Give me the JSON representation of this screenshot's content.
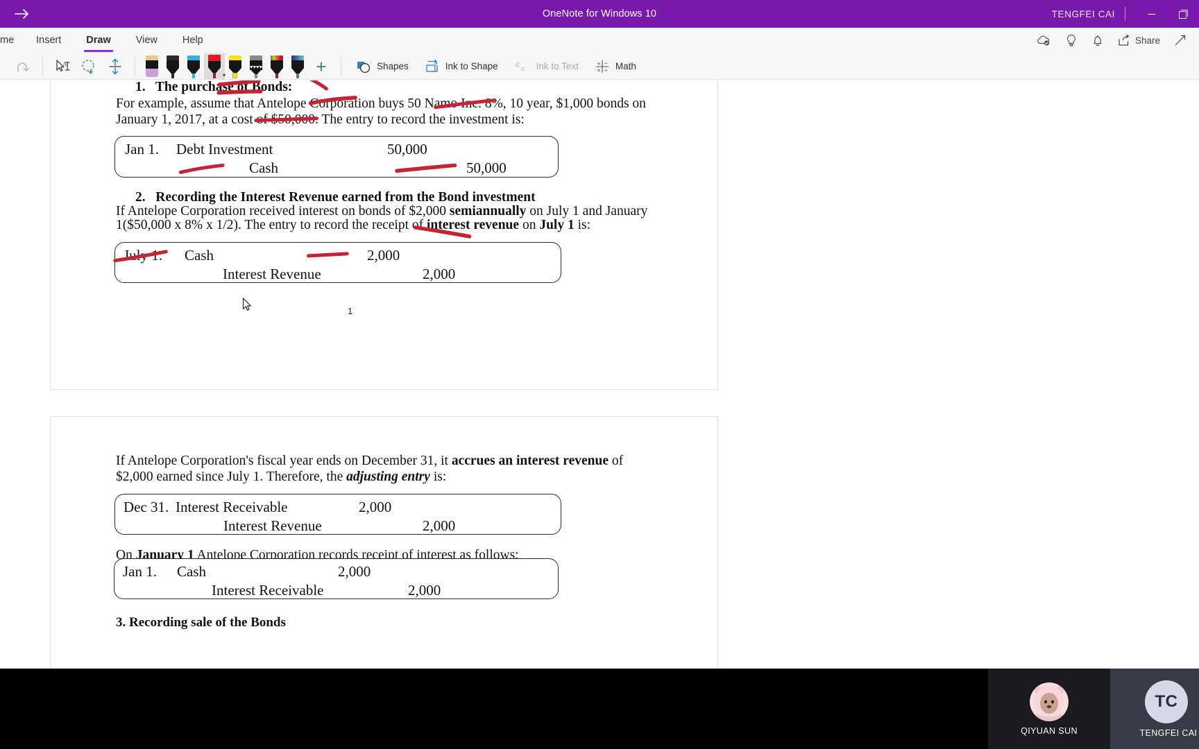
{
  "titlebar": {
    "back_icon": "arrow-right-icon",
    "title": "OneNote for Windows 10",
    "user": "TENGFEI CAI",
    "minimize_label": "Minimize",
    "restore_label": "Restore Down"
  },
  "ribbon": {
    "tabs": [
      {
        "label": "me",
        "name": "tab-home-partial",
        "active": false
      },
      {
        "label": "Insert",
        "name": "tab-insert",
        "active": false
      },
      {
        "label": "Draw",
        "name": "tab-draw",
        "active": true
      },
      {
        "label": "View",
        "name": "tab-view",
        "active": false
      },
      {
        "label": "Help",
        "name": "tab-help",
        "active": false
      }
    ],
    "right_actions": [
      {
        "label": "",
        "icon": "sync-cloud-icon",
        "name": "sync-status-button"
      },
      {
        "label": "",
        "icon": "lightbulb-icon",
        "name": "tell-me-button"
      },
      {
        "label": "",
        "icon": "bell-icon",
        "name": "notifications-button"
      },
      {
        "label": "Share",
        "icon": "share-icon",
        "name": "share-button"
      },
      {
        "label": "",
        "icon": "expand-diagonal-icon",
        "name": "full-page-view-button"
      }
    ],
    "tools": {
      "redo": {
        "label": "Redo",
        "icon": "redo-arrow-icon",
        "disabled": true
      },
      "type": {
        "label": "Type",
        "icon": "select-type-icon",
        "disabled": false
      },
      "lasso": {
        "label": "Lasso Select",
        "icon": "lasso-select-icon",
        "disabled": false
      },
      "insert_space": {
        "label": "Insert Space",
        "icon": "insert-space-icon",
        "disabled": false
      },
      "add_pen": {
        "label": "Add Pen",
        "icon": "plus-icon",
        "disabled": false
      },
      "shapes": {
        "label": "Shapes",
        "icon": "shapes-icon",
        "disabled": false
      },
      "ink_to_shape": {
        "label": "Ink to Shape",
        "icon": "ink-to-shape-icon",
        "disabled": false
      },
      "ink_to_text": {
        "label": "Ink to Text",
        "icon": "ink-to-text-icon",
        "disabled": true
      },
      "math": {
        "label": "Math",
        "icon": "math-icon",
        "disabled": false
      }
    },
    "pens": [
      {
        "name": "pen-eraser",
        "label": "Eraser",
        "cap": "#e8c98a",
        "nib": "#cf9fdc",
        "type": "erase",
        "selected": false
      },
      {
        "name": "pen-black",
        "label": "Black Pen",
        "cap": "#2b2b2b",
        "nib": "#2b2b2b",
        "type": "pen",
        "selected": false
      },
      {
        "name": "pen-blue",
        "label": "Blue Pen",
        "cap": "#2fb3e0",
        "nib": "#2fb3e0",
        "type": "pen",
        "selected": false
      },
      {
        "name": "pen-red",
        "label": "Red Pen",
        "cap": "#e01b24",
        "nib": "#8e2230",
        "type": "pen",
        "selected": true
      },
      {
        "name": "highlighter-yellow",
        "label": "Yellow Highlighter",
        "cap": "#f7e01c",
        "nib": "#f7e01c",
        "type": "hl",
        "selected": false
      },
      {
        "name": "pencil-grey",
        "label": "Pencil",
        "cap": "#8b8b8b",
        "nib": "#8b8b8b",
        "type": "pencil",
        "selected": false
      },
      {
        "name": "pen-rainbow",
        "label": "Rainbow Pen",
        "cap": "rainbow",
        "nib": "#8e2230",
        "type": "pen",
        "selected": false
      },
      {
        "name": "pen-galaxy",
        "label": "Galaxy Pen",
        "cap": "galaxy",
        "nib": "#4a7f9c",
        "type": "pen",
        "selected": false
      }
    ]
  },
  "document": {
    "page1": {
      "section1_number": "1.",
      "section1_heading": "The purchase of Bonds:",
      "para1_line1": "For example, assume that Antelope Corporation buys 50 Namo Inc. 8%, 10 year, $1,000 bonds on",
      "para1_line2": "January 1, 2017, at a cost of $50,000. The entry to record the investment is:",
      "entry1": {
        "date": "Jan 1.",
        "debit_account": "Debt Investment",
        "debit_amount": "50,000",
        "credit_account": "Cash",
        "credit_amount": "50,000"
      },
      "section2_number": "2.",
      "section2_heading": "Recording the Interest Revenue earned from the Bond investment",
      "para2_line1_a": "If Antelope Corporation received interest on bonds of $2,000 ",
      "para2_line1_b": "semiannually",
      "para2_line1_c": " on July 1 and January",
      "para2_line2_a": "1($50,000 x 8% x 1/2). The entry to record the receipt of ",
      "para2_line2_b": "interest revenue",
      "para2_line2_c": " on ",
      "para2_line2_d": "July 1",
      "para2_line2_e": " is:",
      "entry2": {
        "date": "July 1.",
        "debit_account": "Cash",
        "debit_amount": "2,000",
        "credit_account": "Interest Revenue",
        "credit_amount": "2,000"
      },
      "page_number": "1"
    },
    "page2": {
      "para3_line1_a": "If Antelope Corporation's fiscal year ends on December 31, it ",
      "para3_line1_b": "accrues an interest revenue",
      "para3_line1_c": " of",
      "para3_line2_a": "$2,000 earned since July 1. Therefore, the ",
      "para3_line2_b": "adjusting entry",
      "para3_line2_c": " is:",
      "entry3": {
        "date": "Dec 31.",
        "debit_account": "Interest Receivable",
        "debit_amount": "2,000",
        "credit_account": "Interest Revenue",
        "credit_amount": "2,000"
      },
      "para4_a": "On ",
      "para4_b": "January 1",
      "para4_c": " Antelope Corporation records receipt of interest as follows:",
      "entry4": {
        "date": "Jan 1.",
        "debit_account": "Cash",
        "debit_amount": "2,000",
        "credit_account": "Interest Receivable",
        "credit_amount": "2,000"
      },
      "section3_cut": "3. Recording sale of the Bonds"
    }
  },
  "ink_color": "#c42535",
  "video": {
    "participants": [
      {
        "name": "QIYUAN SUN",
        "type": "photo",
        "tile": "video-tile-qiyuan-sun"
      },
      {
        "name": "TENGFEI CAI",
        "type": "initials",
        "initials": "TC",
        "tile": "video-tile-tengfei-cai"
      }
    ]
  }
}
